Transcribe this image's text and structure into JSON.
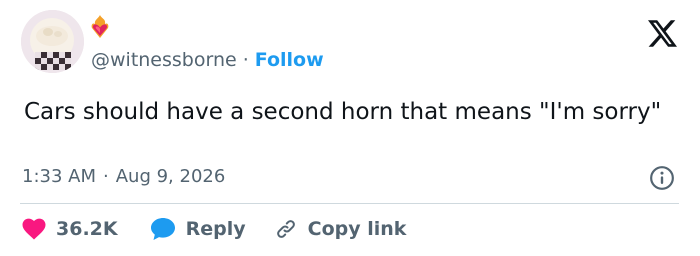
{
  "header": {
    "handle": "@witnessborne",
    "separator": "·",
    "follow_label": "Follow",
    "avatar_icon": "profile-avatar",
    "badge_icon": "flaming-heart-badge",
    "platform_icon": "x-logo"
  },
  "tweet": {
    "text": "Cars should have a second horn that means \"I'm sorry\"",
    "time": "1:33 AM",
    "date_separator": "·",
    "date": "Aug 9, 2026",
    "info_icon": "info-icon"
  },
  "actions": {
    "likes": "36.2K",
    "reply_label": "Reply",
    "copy_label": "Copy link"
  },
  "colors": {
    "accent": "#1d9bf0",
    "heart": "#f91880",
    "text": "#0f1419",
    "muted": "#536471",
    "divider": "#cfd9de"
  }
}
